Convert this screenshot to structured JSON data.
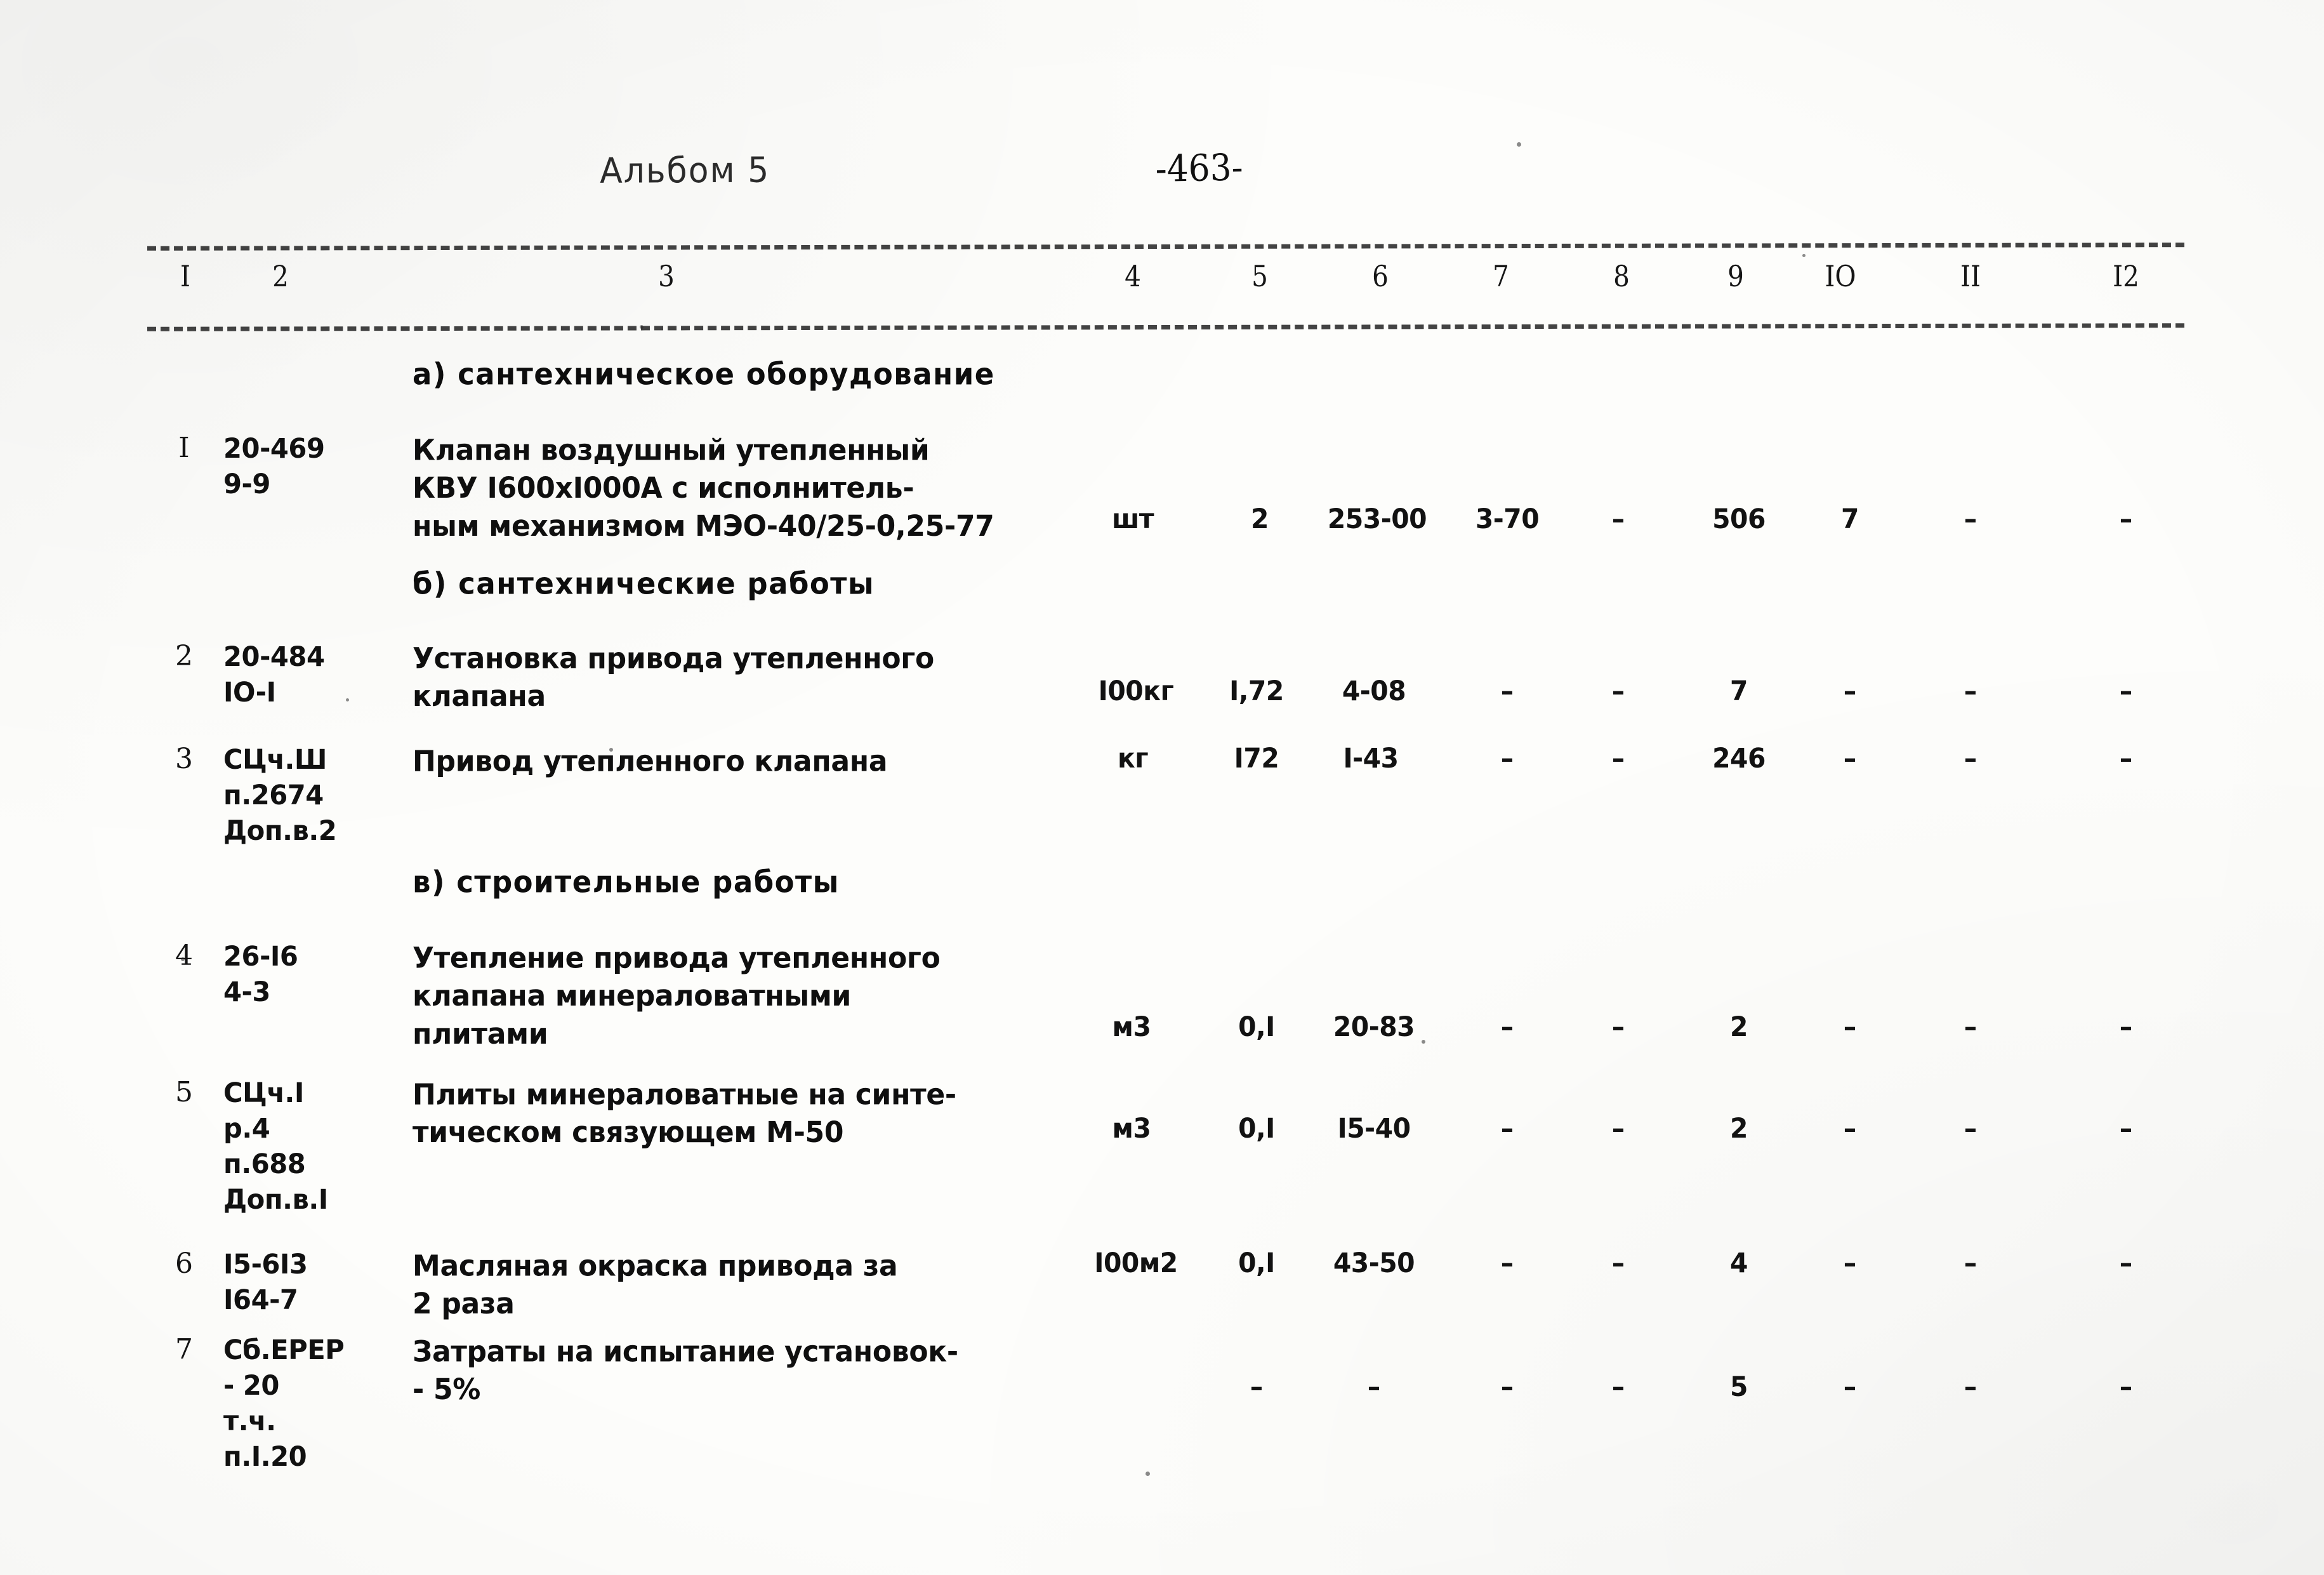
{
  "header": {
    "album_title": "Альбом 5",
    "page_number": "-463-"
  },
  "table": {
    "column_headers": [
      "I",
      "2",
      "3",
      "4",
      "5",
      "6",
      "7",
      "8",
      "9",
      "IO",
      "II",
      "I2"
    ],
    "sections": [
      {
        "label": "а) сантехническое оборудование"
      },
      {
        "label": "б) сантехнические работы"
      },
      {
        "label": "в) строительные работы"
      }
    ],
    "rows": [
      {
        "num": "I",
        "code": "20-469\n9-9",
        "desc": "Клапан воздушный утепленный\nКВУ I600хI000А с исполнитель-\nным механизмом МЭО-40/25-0,25-77",
        "unit": "шт",
        "c5": "2",
        "c6": "253-00",
        "c7": "3-70",
        "c8": "–",
        "c9": "506",
        "c10": "7",
        "c11": "–",
        "c12": "–"
      },
      {
        "num": "2",
        "code": "20-484\nIO-I",
        "desc": "Установка привода утепленного\nклапана",
        "unit": "I00кг",
        "c5": "I,72",
        "c6": "4-08",
        "c7": "–",
        "c8": "–",
        "c9": "7",
        "c10": "–",
        "c11": "–",
        "c12": "–"
      },
      {
        "num": "3",
        "code": "СЦч.Ш\nп.2674\nДоп.в.2",
        "desc": "Привод утепленного клапана",
        "unit": "кг",
        "c5": "I72",
        "c6": "I-43",
        "c7": "–",
        "c8": "–",
        "c9": "246",
        "c10": "–",
        "c11": "–",
        "c12": "–"
      },
      {
        "num": "4",
        "code": "26-I6\n4-3",
        "desc": "Утепление привода утепленного\nклапана минераловатными\nплитами",
        "unit": "м3",
        "c5": "0,I",
        "c6": "20-83",
        "c7": "–",
        "c8": "–",
        "c9": "2",
        "c10": "–",
        "c11": "–",
        "c12": "–"
      },
      {
        "num": "5",
        "code": "СЦч.I\nр.4\nп.688\nДоп.в.I",
        "desc": "Плиты минераловатные на синте-\nтическом связующем М-50",
        "unit": "м3",
        "c5": "0,I",
        "c6": "I5-40",
        "c7": "–",
        "c8": "–",
        "c9": "2",
        "c10": "–",
        "c11": "–",
        "c12": "–"
      },
      {
        "num": "6",
        "code": "I5-6I3\nI64-7",
        "desc": "Масляная окраска привода за\n2 раза",
        "unit": "I00м2",
        "c5": "0,I",
        "c6": "43-50",
        "c7": "–",
        "c8": "–",
        "c9": "4",
        "c10": "–",
        "c11": "–",
        "c12": "–"
      },
      {
        "num": "7",
        "code": "Сб.ЕРЕР\n- 20\nт.ч.\nп.I.20",
        "desc": "Затраты на испытание установок-\n- 5%",
        "unit": "",
        "c5": "–",
        "c6": "–",
        "c7": "–",
        "c8": "–",
        "c9": "5",
        "c10": "–",
        "c11": "–",
        "c12": "–"
      }
    ]
  }
}
